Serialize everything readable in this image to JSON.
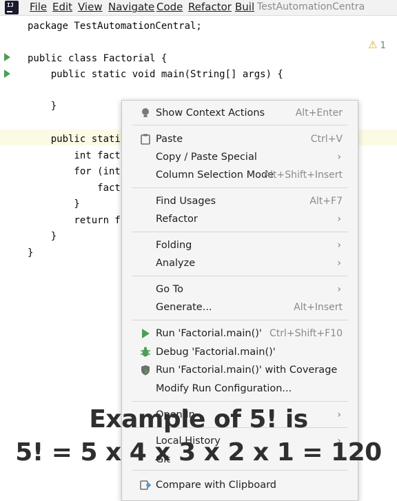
{
  "menubar": {
    "items": [
      "File",
      "Edit",
      "View",
      "Navigate",
      "Code",
      "Refactor",
      "Buil"
    ],
    "project_title": "TestAutomationCentra"
  },
  "editor": {
    "warning_count": "1",
    "lines": [
      "package TestAutomationCentral;",
      "public class Factorial {",
      "    public static void main(String[] args) {",
      "    }",
      "    public stati",
      "        int fact",
      "        for (int",
      "            fact",
      "        }",
      "        return f",
      "    }",
      "}"
    ]
  },
  "context_menu": {
    "items": [
      {
        "label": "Show Context Actions",
        "shortcut": "Alt+Enter",
        "icon": "lightbulb-icon"
      },
      {
        "label": "Paste",
        "shortcut": "Ctrl+V",
        "icon": "clipboard-icon"
      },
      {
        "label": "Copy / Paste Special",
        "submenu": true
      },
      {
        "label": "Column Selection Mode",
        "shortcut": "Alt+Shift+Insert"
      },
      {
        "label": "Find Usages",
        "shortcut": "Alt+F7"
      },
      {
        "label": "Refactor",
        "submenu": true
      },
      {
        "label": "Folding",
        "submenu": true
      },
      {
        "label": "Analyze",
        "submenu": true
      },
      {
        "label": "Go To",
        "submenu": true
      },
      {
        "label": "Generate...",
        "shortcut": "Alt+Insert"
      },
      {
        "label": "Run 'Factorial.main()'",
        "shortcut": "Ctrl+Shift+F10",
        "icon": "run-icon"
      },
      {
        "label": "Debug 'Factorial.main()'",
        "icon": "debug-icon"
      },
      {
        "label": "Run 'Factorial.main()' with Coverage",
        "icon": "coverage-icon"
      },
      {
        "label": "Modify Run Configuration..."
      },
      {
        "label": "Open In",
        "submenu": true
      },
      {
        "label": "Local History",
        "submenu": true
      },
      {
        "label": "Git"
      },
      {
        "label": "Compare with Clipboard",
        "icon": "compare-icon"
      }
    ]
  },
  "caption": {
    "line1": "Example of 5! is",
    "line2": "5! = 5 x 4 x 3 x 2 x 1 = 120"
  },
  "colors": {
    "keyword": "#0033b3",
    "run_green": "#4c9e57",
    "highlight": "#fcfae5",
    "warning": "#e3a41b"
  }
}
